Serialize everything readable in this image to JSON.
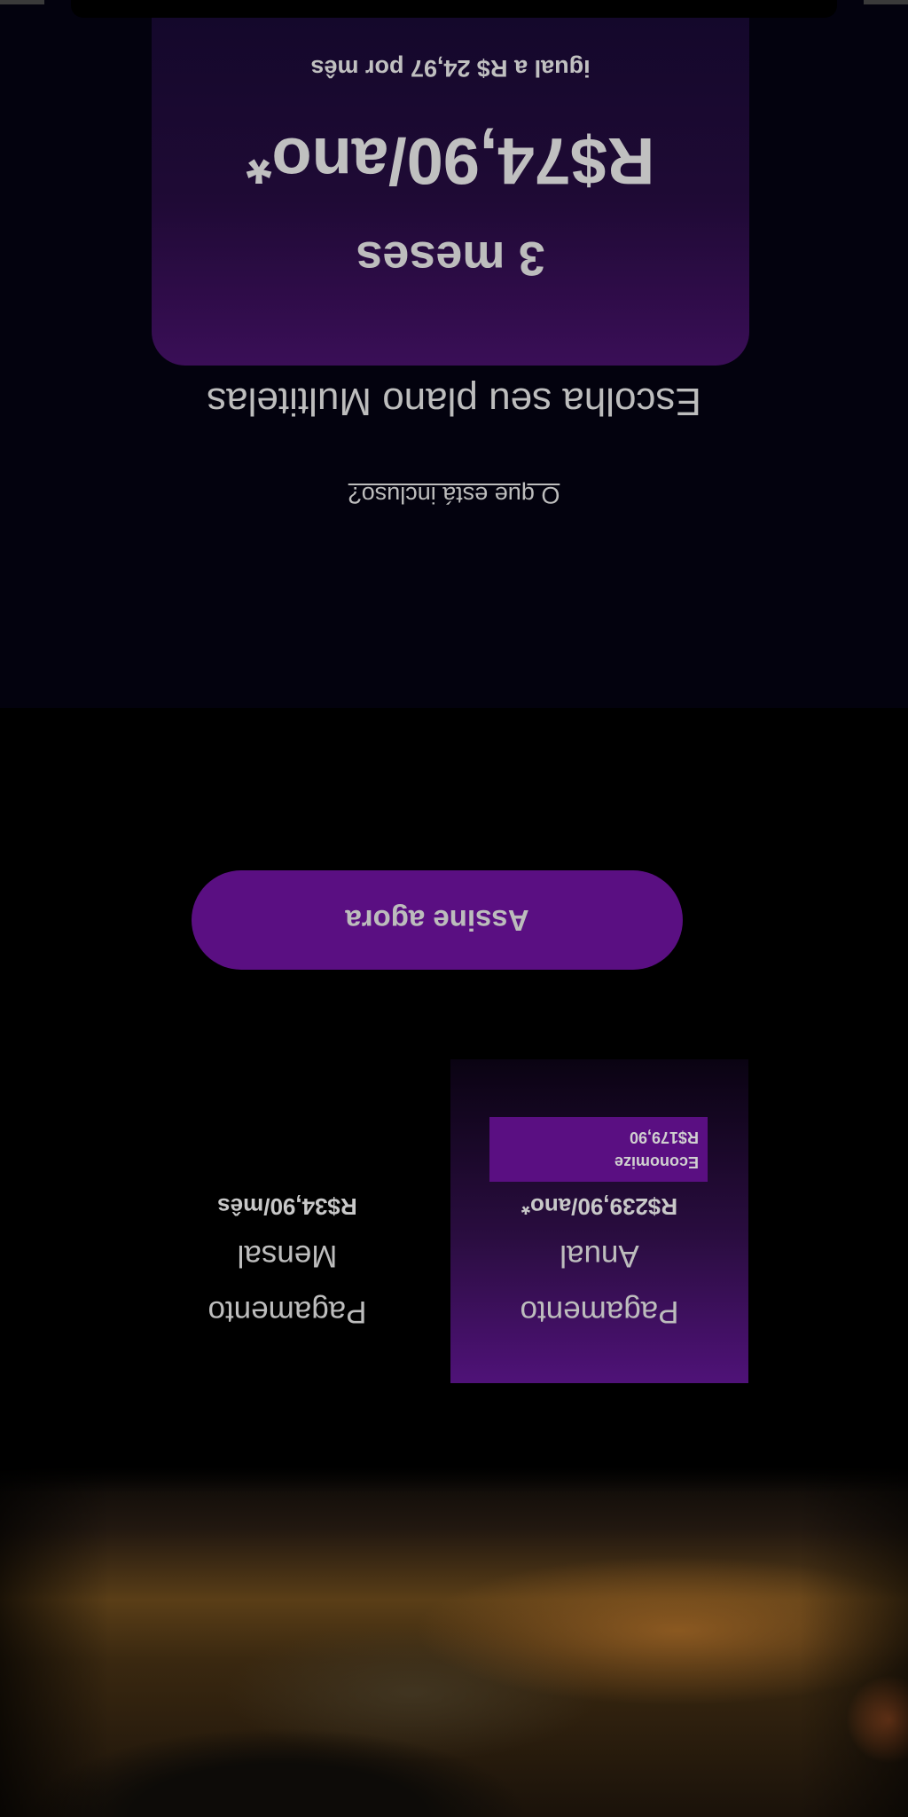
{
  "payment": {
    "annual": {
      "title_line1": "Pagamento",
      "title_line2": "Anual",
      "price": "R$239,90/ano*",
      "savings_label": "Economize",
      "savings_value": "R$179,90"
    },
    "monthly": {
      "title_line1": "Pagamento",
      "title_line2": "Mensal",
      "price": "R$34,90/mês"
    }
  },
  "cta": {
    "label": "Assine agora"
  },
  "plans": {
    "title": "Escolha seu plano Multitelas",
    "included_link": "O que está incluso?",
    "card": {
      "duration": "3 meses",
      "price": "R$74,90/ano*",
      "per_month": "igual a R$ 24,97 por mês"
    }
  },
  "colors": {
    "accent": "#5a0f82",
    "background": "#000000",
    "section_bg": "#03020e",
    "text": "#bdbdbd"
  },
  "display": {
    "rotation": "180deg (screenshot captured upside down)"
  }
}
